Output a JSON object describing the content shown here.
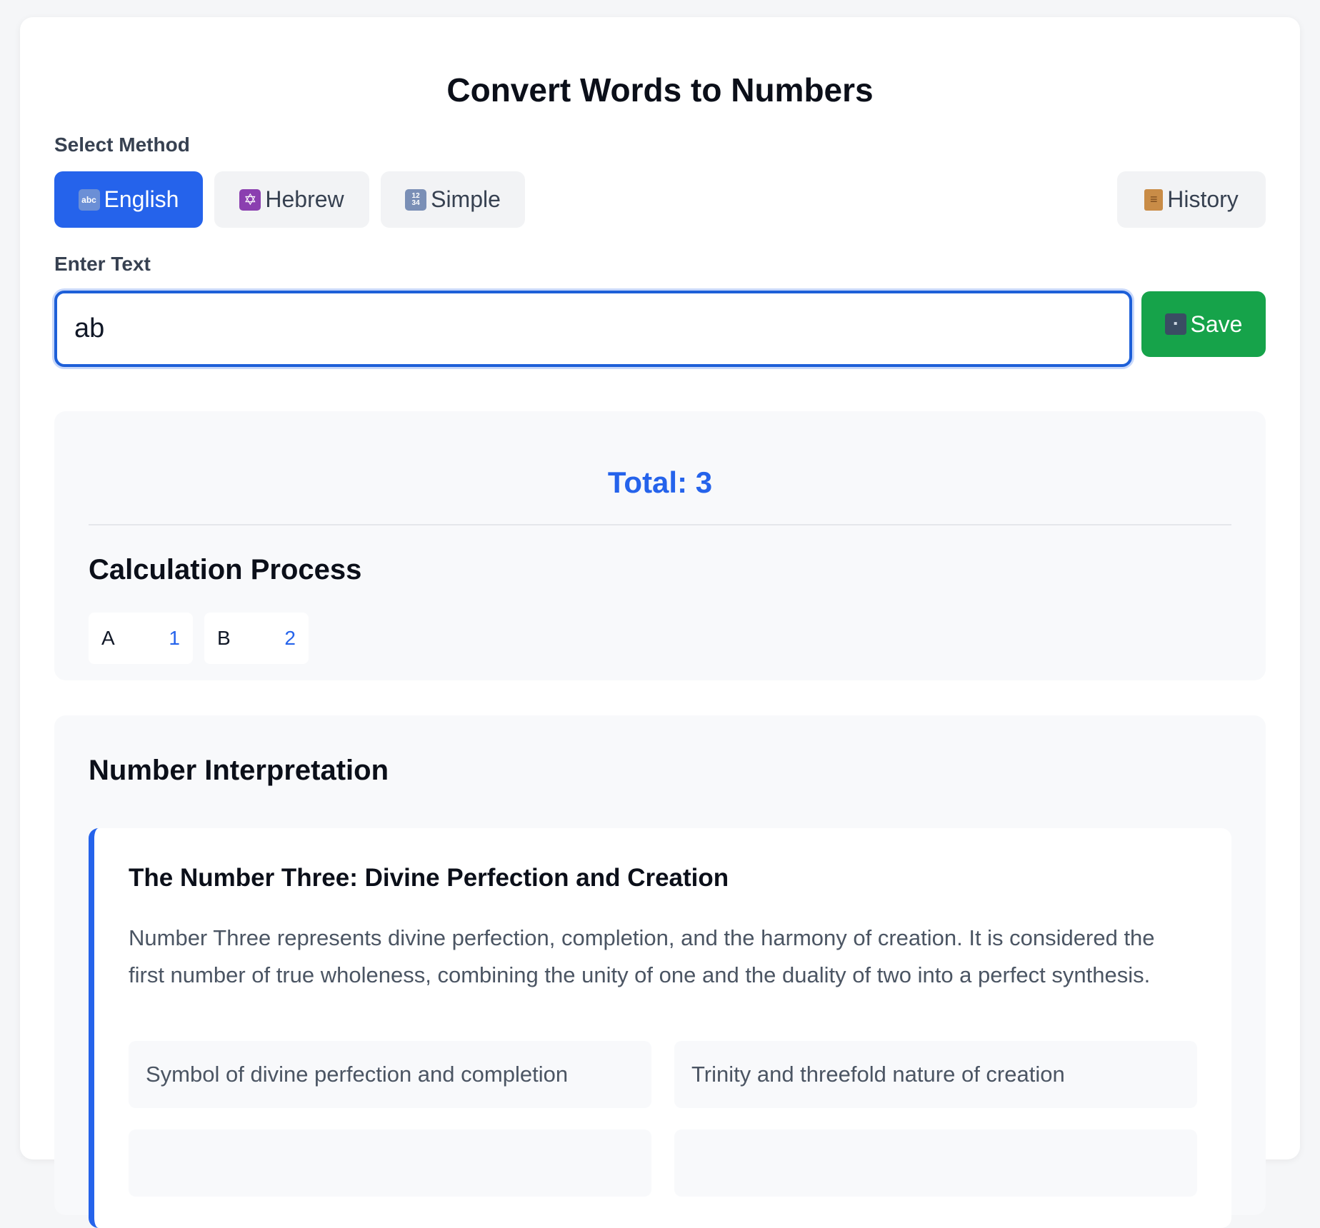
{
  "page": {
    "title": "Convert Words to Numbers"
  },
  "method": {
    "label": "Select Method",
    "options": [
      {
        "label": "English",
        "icon": "abc-icon",
        "active": true
      },
      {
        "label": "Hebrew",
        "icon": "star-of-david-icon",
        "active": false
      },
      {
        "label": "Simple",
        "icon": "numbers-icon",
        "active": false
      }
    ],
    "history_label": "History"
  },
  "input": {
    "label": "Enter Text",
    "value": "ab",
    "save_label": "Save"
  },
  "result": {
    "total": "Total: 3",
    "process_title": "Calculation Process",
    "letters": [
      {
        "char": "A",
        "value": "1"
      },
      {
        "char": "B",
        "value": "2"
      }
    ]
  },
  "interpretation": {
    "section_title": "Number Interpretation",
    "heading": "The Number Three: Divine Perfection and Creation",
    "description": "Number Three represents divine perfection, completion, and the harmony of creation. It is considered the first number of true wholeness, combining the unity of one and the duality of two into a perfect synthesis.",
    "traits": [
      "Symbol of divine perfection and completion",
      "Trinity and threefold nature of creation",
      "",
      ""
    ]
  },
  "colors": {
    "primary": "#2563eb",
    "success": "#16a34a",
    "muted_bg": "#f8f9fb"
  }
}
